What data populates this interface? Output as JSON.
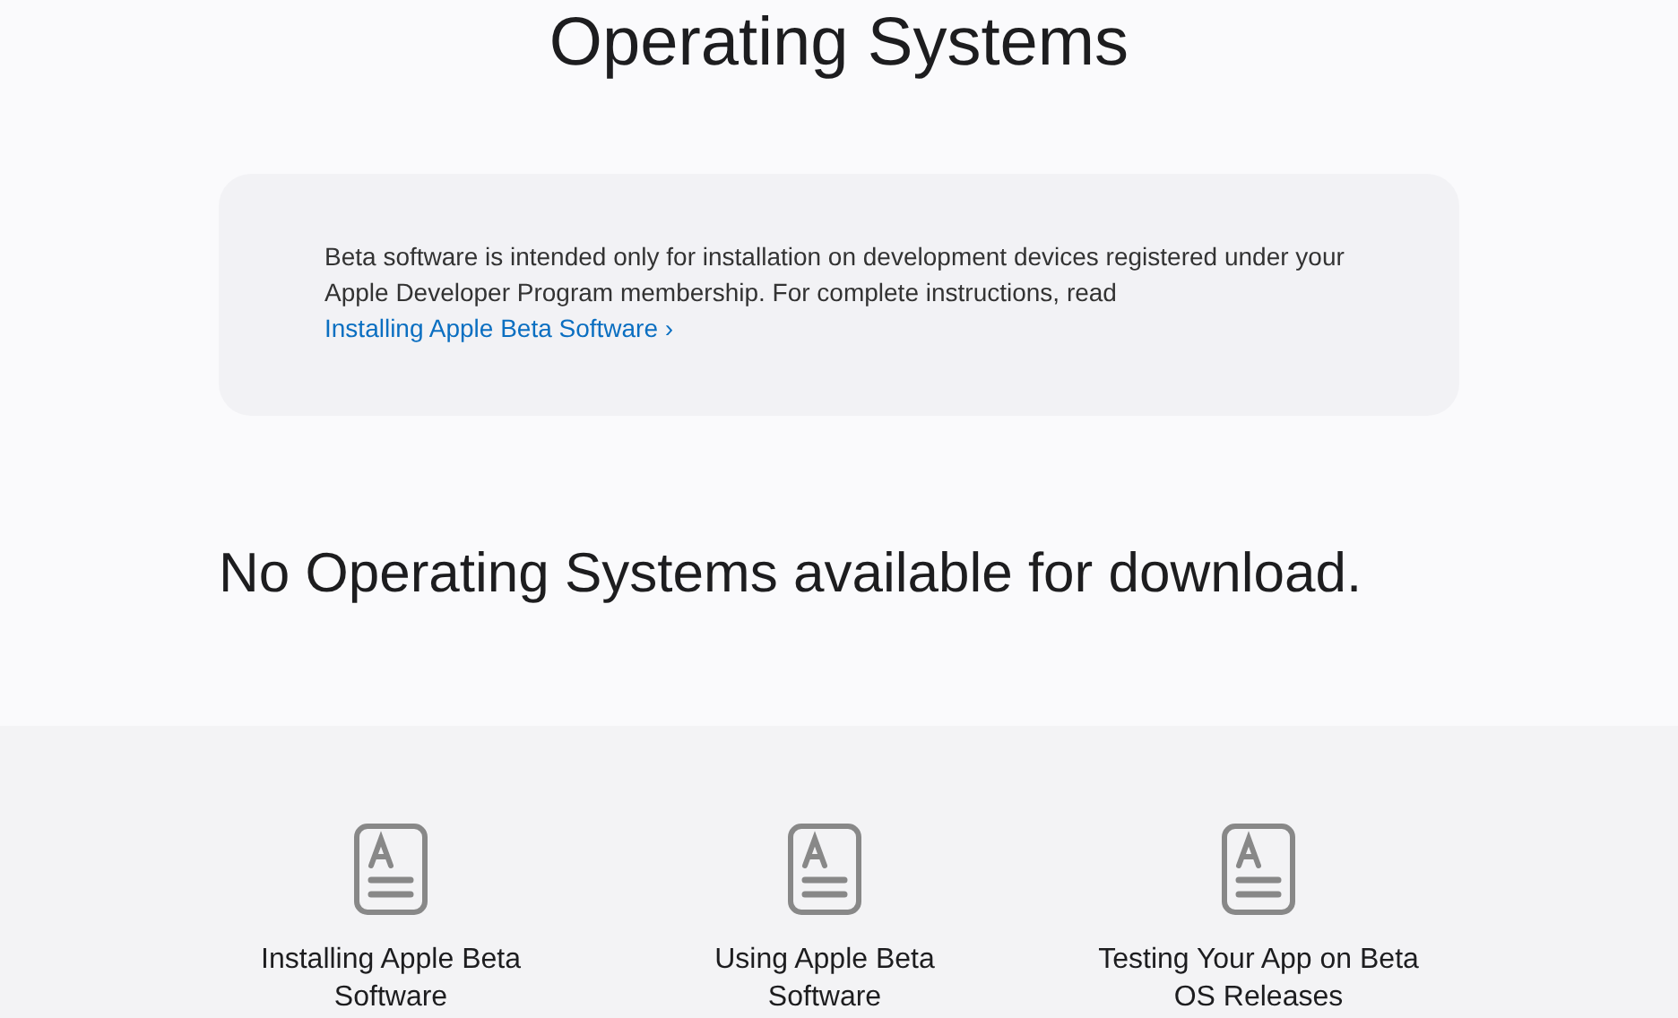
{
  "title": "Operating Systems",
  "notice": {
    "text": "Beta software is intended only for installation on development devices registered under your Apple Developer Program membership. For complete instructions, read",
    "link": "Installing Apple Beta Software ›"
  },
  "empty_message": "No Operating Systems available for download.",
  "resources": [
    {
      "label": "Installing Apple Beta Software"
    },
    {
      "label": "Using Apple Beta Software"
    },
    {
      "label": "Testing Your App on Beta OS Releases"
    }
  ]
}
